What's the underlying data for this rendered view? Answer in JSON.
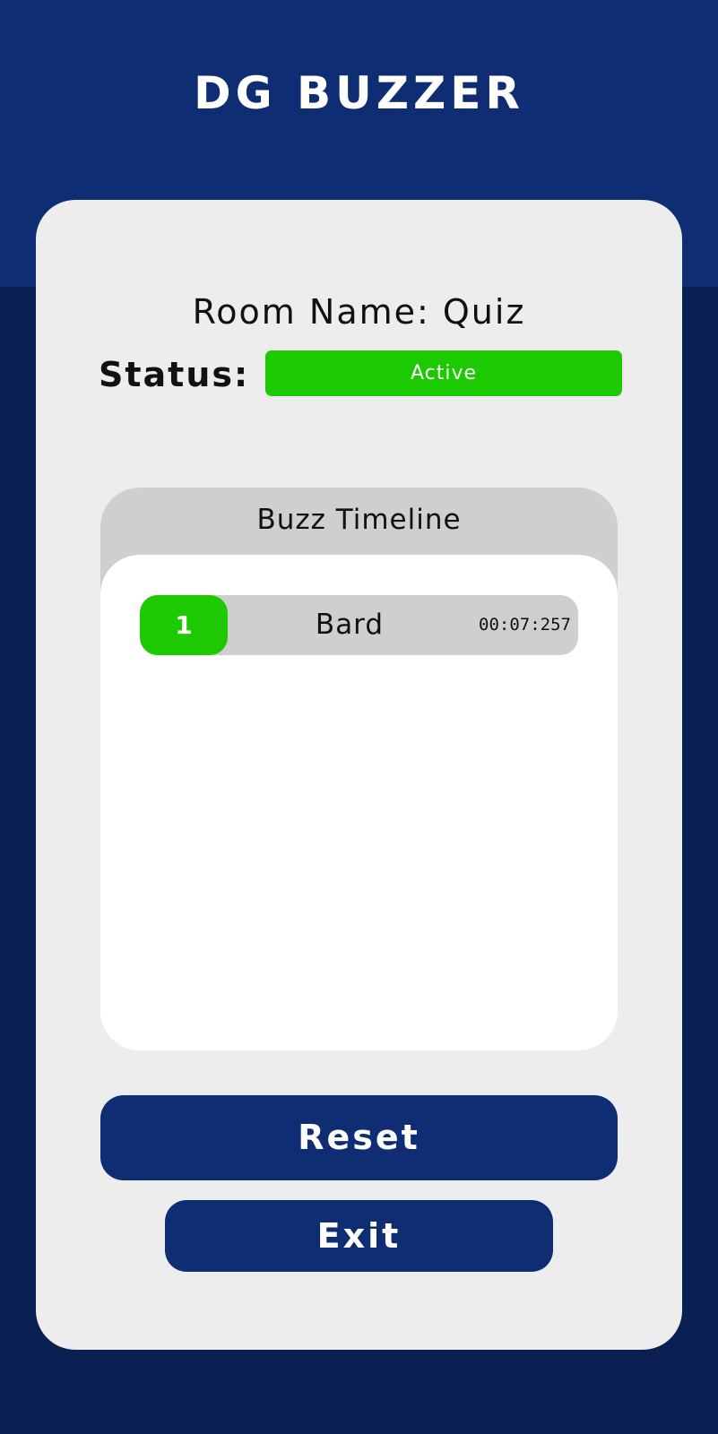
{
  "app": {
    "title": "DG BUZZER"
  },
  "room": {
    "name_text": "Room Name: Quiz",
    "status_label": "Status:",
    "status_value": "Active"
  },
  "timeline": {
    "title": "Buzz Timeline",
    "entries": [
      {
        "rank": "1",
        "name": "Bard",
        "time": "00:07:257"
      }
    ]
  },
  "actions": {
    "reset_label": "Reset",
    "exit_label": "Exit"
  },
  "colors": {
    "header_blue": "#0f2d72",
    "background_navy": "#0a1f52",
    "card": "#ededed",
    "active_green": "#1dc900",
    "timeline_grey": "#cfcfcf"
  }
}
